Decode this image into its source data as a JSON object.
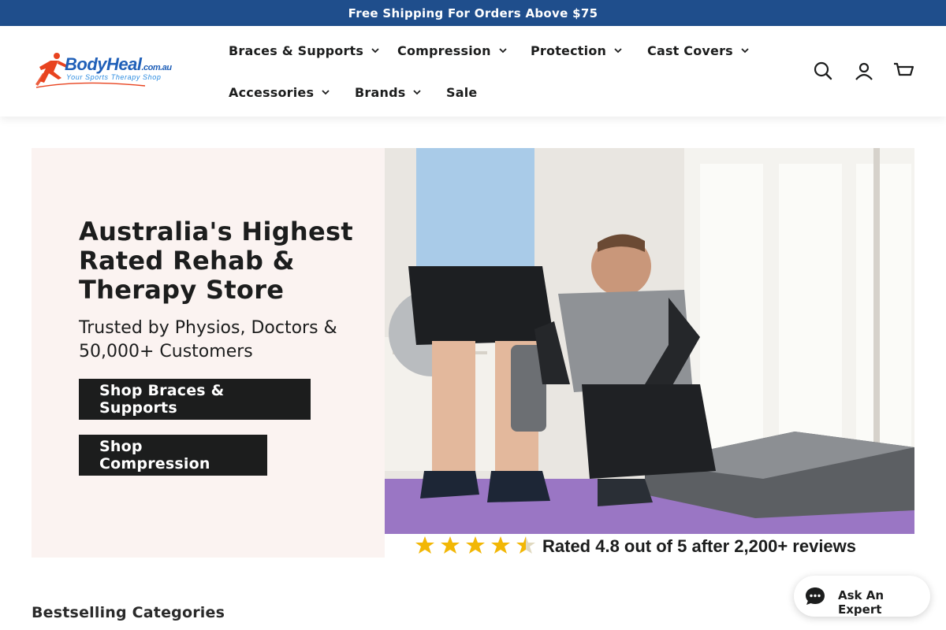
{
  "announcement": {
    "text": "Free Shipping For Orders Above $75"
  },
  "logo": {
    "name": "BodyHeal",
    "tld": ".com.au",
    "tagline": "Your Sports Therapy Shop"
  },
  "nav": {
    "items": [
      {
        "label": "Braces & Supports",
        "has_dropdown": true
      },
      {
        "label": "Compression",
        "has_dropdown": true
      },
      {
        "label": "Protection",
        "has_dropdown": true
      },
      {
        "label": "Cast Covers",
        "has_dropdown": true
      },
      {
        "label": "Accessories",
        "has_dropdown": true
      },
      {
        "label": "Brands",
        "has_dropdown": true
      },
      {
        "label": "Sale",
        "has_dropdown": false
      }
    ]
  },
  "header_icons": [
    "search-icon",
    "account-icon",
    "cart-icon"
  ],
  "hero": {
    "title": "Australia's Highest Rated Rehab & Therapy Store",
    "subtitle": "Trusted by Physios, Doctors & 50,000+ Customers",
    "buttons": [
      {
        "label": "Shop Braces & Supports"
      },
      {
        "label": "Shop Compression"
      }
    ],
    "rating": {
      "stars": 4.5,
      "max": 5,
      "text": "Rated 4.8 out of 5 after 2,200+ reviews"
    }
  },
  "section": {
    "title": "Bestselling Categories"
  },
  "chat": {
    "label": "Ask An Expert"
  },
  "colors": {
    "announcement_bg": "#1f4e8c",
    "hero_bg": "#fbf3f1",
    "button_bg": "#1c1d1d",
    "star": "#f2b705",
    "logo_blue": "#1f5fb8",
    "logo_red": "#e8431f"
  }
}
